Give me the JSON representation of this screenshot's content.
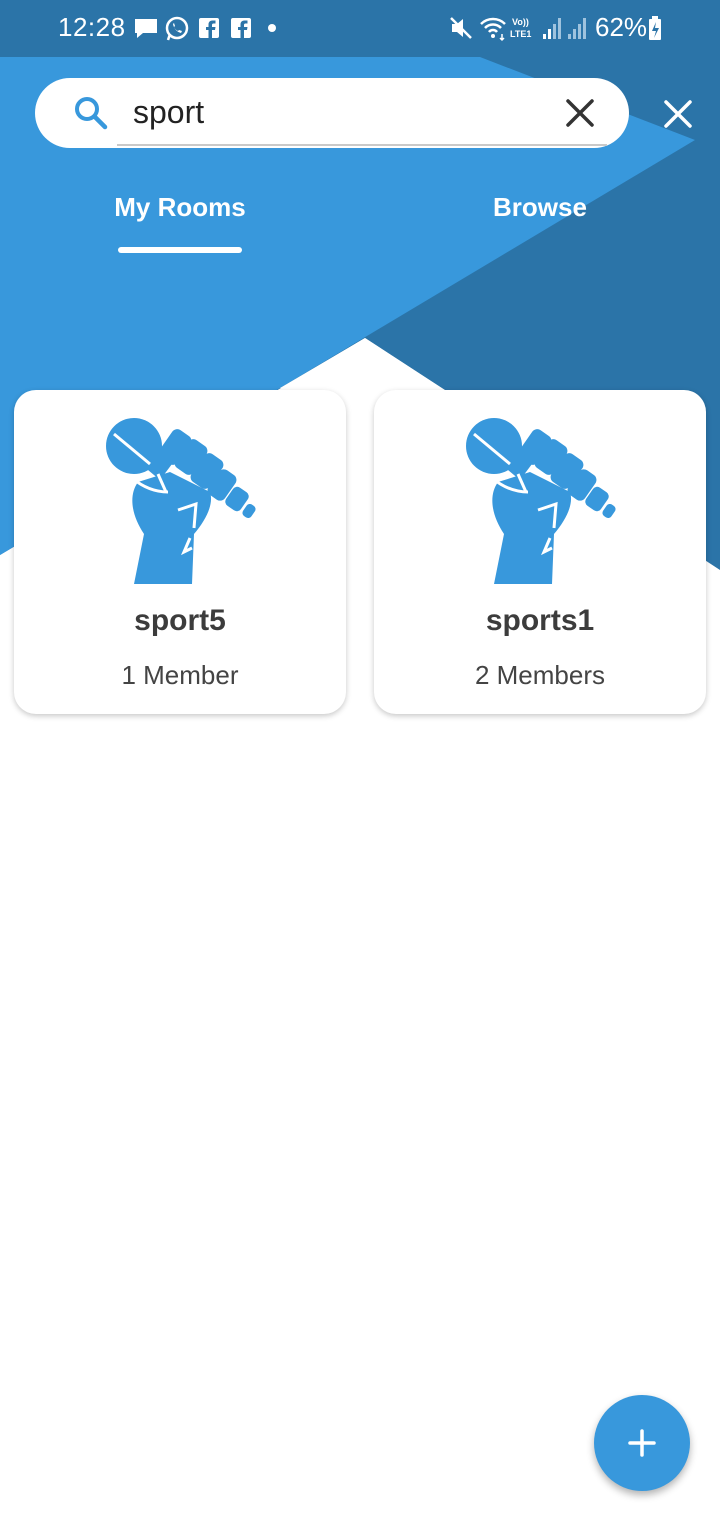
{
  "colors": {
    "header_dark": "#2b74a8",
    "header_light": "#3898dc",
    "accent": "#3898dc",
    "card_text": "#3c3c3c"
  },
  "status_bar": {
    "time": "12:28",
    "battery": "62%",
    "icons": [
      "message-icon",
      "whatsapp-icon",
      "facebook-icon",
      "facebook-icon",
      "dot-icon",
      "mute-icon",
      "wifi-icon",
      "lte-icon",
      "signal-icon",
      "signal-icon",
      "battery-icon"
    ]
  },
  "search": {
    "value": "sport",
    "icon": "search-icon",
    "clear_icon": "close-icon"
  },
  "close_icon": "close-icon",
  "tabs": [
    {
      "label": "My Rooms",
      "active": true
    },
    {
      "label": "Browse",
      "active": false
    }
  ],
  "rooms": [
    {
      "name": "sport5",
      "members": "1 Member",
      "icon": "microphone-fist-icon"
    },
    {
      "name": "sports1",
      "members": "2 Members",
      "icon": "microphone-fist-icon"
    }
  ],
  "fab": {
    "icon": "plus-icon"
  }
}
